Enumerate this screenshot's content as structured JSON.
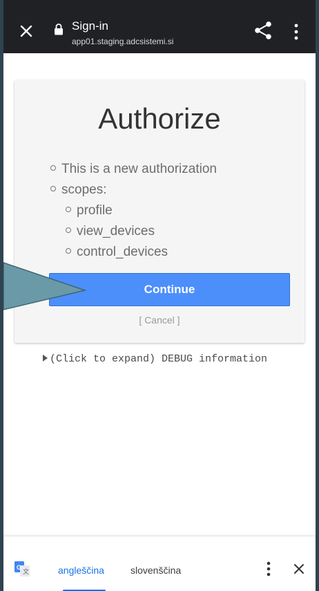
{
  "topbar": {
    "title": "Sign-in",
    "url": "app01.staging.adcsistemi.si",
    "background": "#202124"
  },
  "card": {
    "title": "Authorize",
    "items": [
      {
        "text": "This is a new authorization",
        "level": 0
      },
      {
        "text": "scopes:",
        "level": 0
      },
      {
        "text": "profile",
        "level": 1
      },
      {
        "text": "view_devices",
        "level": 1
      },
      {
        "text": "control_devices",
        "level": 1
      }
    ],
    "continue_label": "Continue",
    "cancel_label": "[ Cancel ]",
    "accent": "#4c8ffb"
  },
  "debug": {
    "label": "(Click to expand) DEBUG information"
  },
  "translate": {
    "source_lang": "angleščina",
    "target_lang": "slovenščina",
    "accent": "#1a73e8"
  },
  "icons": {
    "close": "close-icon",
    "lock": "lock-icon",
    "share": "share-icon",
    "more": "more-vert-icon",
    "translate": "google-translate-icon"
  }
}
